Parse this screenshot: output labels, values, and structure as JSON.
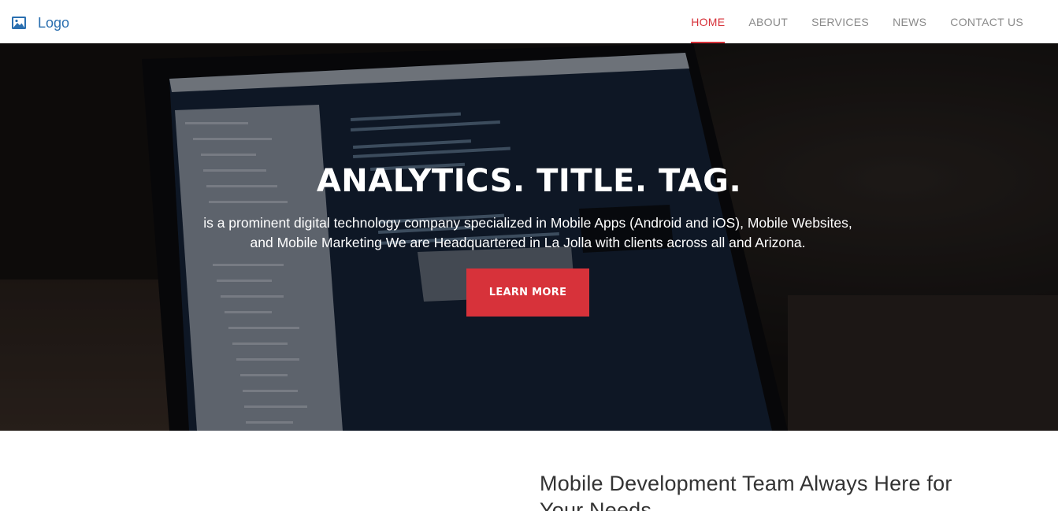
{
  "header": {
    "logo_icon": "image-icon",
    "logo_text": "Logo",
    "nav": [
      {
        "label": "HOME",
        "active": true
      },
      {
        "label": "ABOUT",
        "active": false
      },
      {
        "label": "SERVICES",
        "active": false
      },
      {
        "label": "NEWS",
        "active": false
      },
      {
        "label": "CONTACT US",
        "active": false
      }
    ]
  },
  "hero": {
    "title": "ANALYTICS. TITLE. TAG.",
    "subtitle": "is a prominent digital technology company specialized in Mobile Apps (Android and iOS), Mobile Websites, and Mobile Marketing We are Headquartered in La Jolla with clients across all and Arizona.",
    "button_label": "LEARN MORE",
    "background_image": "laptop-code-editor-photo"
  },
  "section": {
    "heading": "Mobile Development Team Always Here for Your Needs"
  },
  "colors": {
    "accent": "#d7323a",
    "logo": "#2a6fb0",
    "nav_text": "#8a8a8a"
  }
}
